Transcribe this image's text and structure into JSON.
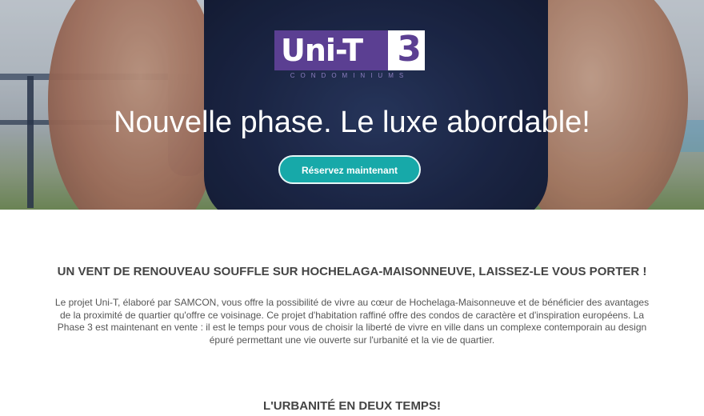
{
  "hero": {
    "logo_text": "Uni-T",
    "logo_number": "3",
    "logo_subtitle": "CONDOMINIUMS",
    "title": "Nouvelle phase. Le luxe abordable!",
    "cta_label": "Réservez maintenant"
  },
  "section1": {
    "heading": "UN VENT DE RENOUVEAU SOUFFLE SUR HOCHELAGA-MAISONNEUVE, LAISSEZ-LE VOUS PORTER !",
    "paragraph": "Le projet Uni-T, élaboré par SAMCON, vous offre la possibilité de vivre au cœur de Hochelaga-Maisonneuve et de bénéficier des avantages de la proximité de quartier qu'offre ce voisinage. Ce projet d'habitation raffiné offre des condos de caractère et d'inspiration européens. La Phase 3 est maintenant en vente : il est le temps pour vous de choisir la liberté de vivre en ville dans un complexe contemporain au design épuré permettant une vie ouverte sur l'urbanité et la vie de quartier."
  },
  "section2": {
    "heading": "L'URBANITÉ EN DEUX TEMPS!"
  },
  "colors": {
    "brand_purple": "#5b3f92",
    "cta_teal": "#17a9a9"
  }
}
